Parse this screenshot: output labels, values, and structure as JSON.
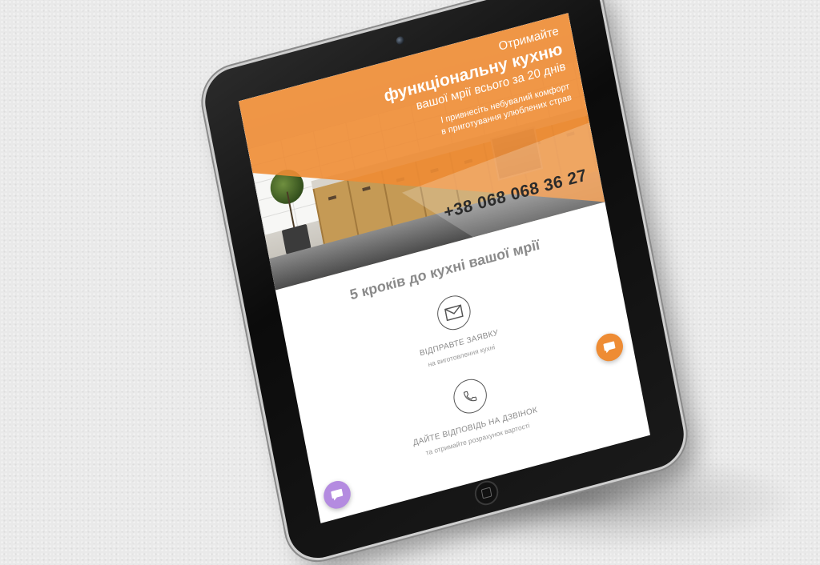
{
  "hero": {
    "title_top": "Отримайте",
    "title_main": "функціональну кухню",
    "title_sub": "вашої мрії всього за 20 днів",
    "desc_line1": "І привнесіть небувалий комфорт",
    "desc_line2": "в приготування улюблених страв",
    "phone": "+38 068 068 36 27"
  },
  "section": {
    "title": "5 кроків до кухні вашої мрії"
  },
  "steps": [
    {
      "icon": "envelope-icon",
      "title": "ВІДПРАВТЕ ЗАЯВКУ",
      "subtitle": "на виготовлення кухні"
    },
    {
      "icon": "phone-icon",
      "title": "ДАЙТЕ ВІДПОВІДЬ НА ДЗВІНОК",
      "subtitle": "та отримайте розрахунок вартості"
    }
  ],
  "colors": {
    "accent_orange": "#ee8c34",
    "chat_purple": "#b48be0",
    "text_gray": "#8a8a8a"
  },
  "icons": {
    "chat_orange": "chat-bubble-icon",
    "chat_purple": "chat-bubble-icon"
  }
}
